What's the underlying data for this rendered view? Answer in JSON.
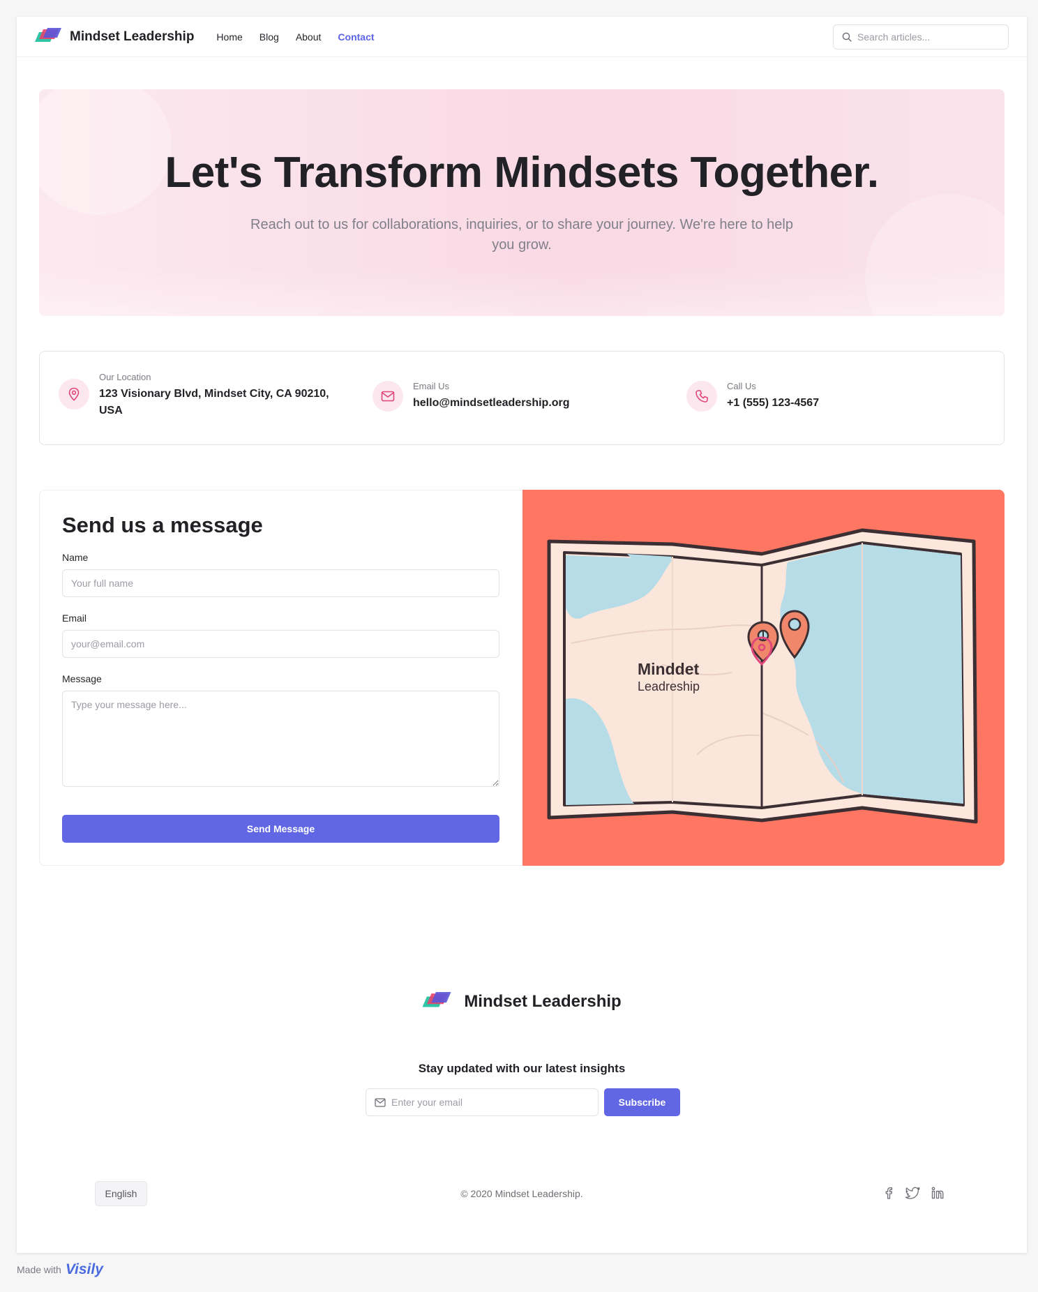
{
  "nav": {
    "brand": "Mindset Leadership",
    "links": [
      {
        "label": "Home"
      },
      {
        "label": "Blog"
      },
      {
        "label": "About"
      },
      {
        "label": "Contact"
      }
    ],
    "search_placeholder": "Search articles..."
  },
  "hero": {
    "title": "Let's Transform Mindsets Together.",
    "subtitle": "Reach out to us for collaborations, inquiries, or to share your journey. We're here to help you grow."
  },
  "contact_info": {
    "location_label": "Our Location",
    "location_value": "123 Visionary Blvd, Mindset City, CA 90210, USA",
    "email_label": "Email Us",
    "email_value": "hello@mindsetleadership.org",
    "phone_label": "Call Us",
    "phone_value": "+1 (555) 123-4567"
  },
  "form": {
    "title": "Send us a message",
    "name_label": "Name",
    "name_placeholder": "Your full name",
    "email_label": "Email",
    "email_placeholder": "your@email.com",
    "message_label": "Message",
    "message_placeholder": "Type your message here...",
    "submit_label": "Send Message"
  },
  "map": {
    "title_line1": "Minddet",
    "title_line2": "Leadreship"
  },
  "footer": {
    "brand": "Mindset Leadership",
    "newsletter_title": "Stay updated with our latest insights",
    "newsletter_placeholder": "Enter your email",
    "subscribe_label": "Subscribe",
    "language": "English",
    "copyright": "© 2020 Mindset Leadership."
  },
  "made_with": {
    "text": "Made with",
    "logo": "Visily"
  },
  "colors": {
    "accent": "#6167e4",
    "hero_bg": "#f9d9e4",
    "map_bg": "#ff7663",
    "icon_pink": "#e0457b"
  }
}
